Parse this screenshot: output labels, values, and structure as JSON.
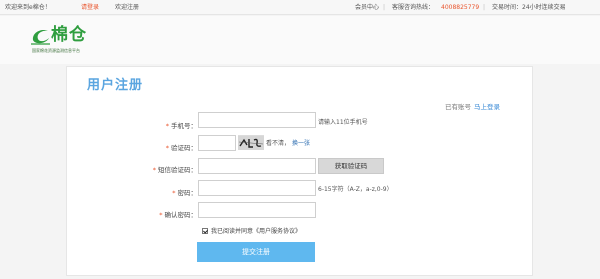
{
  "topbar": {
    "welcome": "欢迎来到e棉仓！",
    "login": "请登录",
    "register": "欢迎注册",
    "member_center": "会员中心",
    "hotline_label": "客服咨询热线：",
    "hotline_number": "4008825779",
    "hours": "交易时间：24小时连续交易",
    "separator": "|"
  },
  "logo": {
    "name": "棉仓",
    "tagline": "国家棉花资源监测信息平台"
  },
  "form": {
    "title": "用户注册",
    "have_account": "已有账号",
    "login_now": "马上登录",
    "required_mark": "*",
    "phone": {
      "label": "手机号：",
      "value": "",
      "hint": "请输入11位手机号"
    },
    "captcha": {
      "label": "验证码：",
      "value": "",
      "hint": "看不清，",
      "refresh": "换一张"
    },
    "sms_code": {
      "label": "短信验证码：",
      "value": "",
      "button": "获取验证码"
    },
    "password": {
      "label": "密码：",
      "value": "",
      "hint": "6-15字符（A-Z，a-z,0-9）"
    },
    "confirm_password": {
      "label": "确认密码：",
      "value": ""
    },
    "agree": {
      "text": "我已阅读并同意《用户服务协议》",
      "checked": true
    },
    "submit": "提交注册"
  }
}
